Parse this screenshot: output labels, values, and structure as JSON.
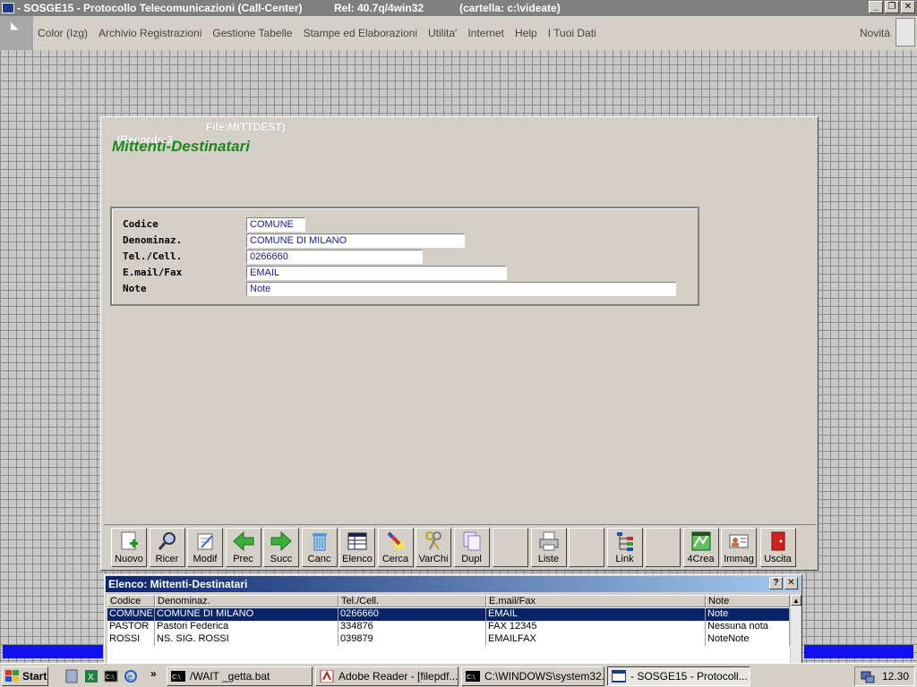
{
  "window": {
    "title": "- SOSGE15 - Protocollo Telecomunicazioni (Call-Center)",
    "release": "Rel: 40.7q/4win32",
    "folder": "(cartella: c:\\videate)"
  },
  "menu": {
    "items": [
      "Color (Izg)",
      "Archivio Registrazioni",
      "Gestione Tabelle",
      "Stampe ed Elaborazioni",
      "Utilita'",
      "Internet",
      "Help",
      "I Tuoi Dati"
    ],
    "novita": "Novità"
  },
  "main": {
    "records": "(Records:3",
    "file": "File:MITTDEST)",
    "title": "Mittenti-Destinatari",
    "fields": [
      {
        "label": "Codice",
        "value": "COMUNE"
      },
      {
        "label": "Denominaz.",
        "value": "COMUNE DI MILANO"
      },
      {
        "label": "Tel./Cell.",
        "value": "0266660"
      },
      {
        "label": "E.mail/Fax",
        "value": "EMAIL"
      },
      {
        "label": "Note",
        "value": "Note"
      }
    ]
  },
  "toolbar": {
    "buttons": [
      "Nuovo",
      "Ricer",
      "Modif",
      "Prec",
      "Succ",
      "Canc",
      "Elenco",
      "Cerca",
      "VarChi",
      "Dupl",
      "",
      "Liste",
      "",
      "Link",
      "",
      "4Crea",
      "Immag",
      "Uscita"
    ]
  },
  "list": {
    "title": "Elenco: Mittenti-Destinatari",
    "help": "?",
    "close": "✕",
    "columns": [
      "Codice",
      "Denominaz.",
      "Tel./Cell.",
      "E.mail/Fax",
      "Note"
    ],
    "rows": [
      [
        "COMUNE",
        "COMUNE DI MILANO",
        "0266660",
        "EMAIL",
        "Note"
      ],
      [
        "PASTOR",
        "Pastori Federica",
        "334876",
        "FAX 12345",
        "Nessuna nota"
      ],
      [
        "ROSSI",
        "NS. SIG. ROSSI",
        "039879",
        "EMAILFAX",
        "NoteNote"
      ]
    ]
  },
  "taskbar": {
    "start": "Start",
    "quicklaunch_more": "»",
    "tasks": [
      "/WAIT _getta.bat",
      "Adobe Reader - [filepdf....",
      "C:\\WINDOWS\\system32....",
      "- SOSGE15 - Protocoll..."
    ],
    "clock": "12.30"
  },
  "colors": {
    "form_title": "#1a8a1a",
    "selection": "#0a246a",
    "field_text": "#1a1a8a"
  }
}
